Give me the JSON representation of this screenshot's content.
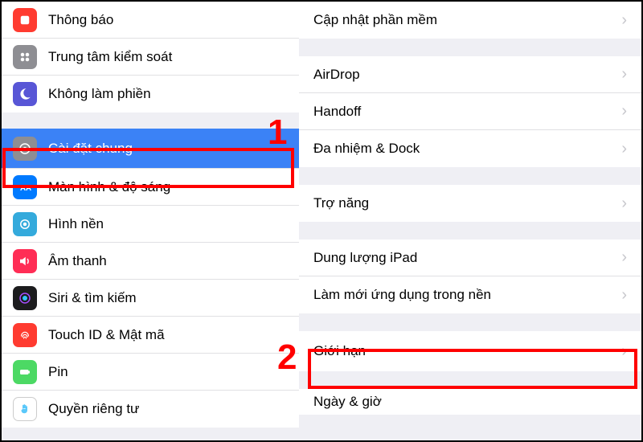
{
  "sidebar": {
    "items": [
      {
        "label": "Thông báo"
      },
      {
        "label": "Trung tâm kiểm soát"
      },
      {
        "label": "Không làm phiền"
      },
      {
        "label": "Cài đặt chung"
      },
      {
        "label": "Màn hình & độ sáng"
      },
      {
        "label": "Hình nền"
      },
      {
        "label": "Âm thanh"
      },
      {
        "label": "Siri & tìm kiếm"
      },
      {
        "label": "Touch ID & Mật mã"
      },
      {
        "label": "Pin"
      },
      {
        "label": "Quyền riêng tư"
      }
    ]
  },
  "main": {
    "software_update": "Cập nhật phần mềm",
    "airdrop": "AirDrop",
    "handoff": "Handoff",
    "multitask": "Đa nhiệm & Dock",
    "accessibility": "Trợ năng",
    "storage": "Dung lượng iPad",
    "background_refresh": "Làm mới ứng dụng trong nền",
    "restrictions": "Giới hạn",
    "date_time": "Ngày & giờ"
  },
  "annotations": {
    "one": "1",
    "two": "2"
  }
}
